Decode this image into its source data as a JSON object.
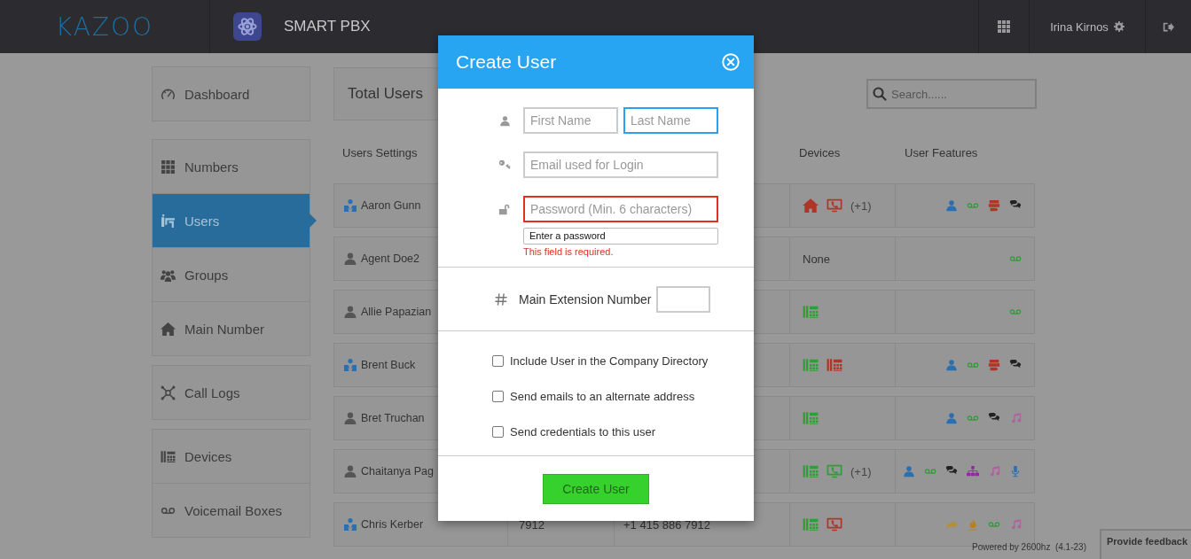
{
  "topbar": {
    "logo": "KAZOO",
    "app_title": "SMART PBX",
    "user_name": "Irina Kirnos"
  },
  "sidebar": {
    "groups": [
      {
        "items": [
          {
            "kind": "dashboard",
            "label": "Dashboard",
            "selected": false
          }
        ]
      },
      {
        "items": [
          {
            "kind": "numbers",
            "label": "Numbers",
            "selected": false
          },
          {
            "kind": "users",
            "label": "Users",
            "selected": true
          },
          {
            "kind": "groups",
            "label": "Groups",
            "selected": false
          },
          {
            "kind": "main_number",
            "label": "Main Number",
            "selected": false
          }
        ]
      },
      {
        "items": [
          {
            "kind": "call_logs",
            "label": "Call Logs",
            "selected": false
          }
        ]
      },
      {
        "items": [
          {
            "kind": "devices",
            "label": "Devices",
            "selected": false
          },
          {
            "kind": "voicemail",
            "label": "Voicemail Boxes",
            "selected": false
          }
        ]
      }
    ]
  },
  "summary": {
    "label": "Total Users"
  },
  "search": {
    "placeholder": "Search......"
  },
  "table": {
    "header": {
      "name": "Users Settings",
      "devices": "Devices",
      "features": "User Features"
    },
    "rows": [
      {
        "name": "Aaron Gunn",
        "kind": "admin",
        "devices": [
          {
            "kind": "landline",
            "color": "#b03527"
          },
          {
            "kind": "softphone",
            "color": "#b03527"
          }
        ],
        "devices_more": "(+1)",
        "features": [
          {
            "kind": "user"
          },
          {
            "kind": "voicemail"
          },
          {
            "kind": "fax"
          },
          {
            "kind": "chat"
          }
        ]
      },
      {
        "name": "Agent Doe2",
        "kind": "user",
        "devices": [],
        "devices_text": "None",
        "features": [
          {
            "kind": "voicemail"
          }
        ]
      },
      {
        "name": "Allie Papazian",
        "kind": "user",
        "devices": [
          {
            "kind": "desk_phone",
            "color": "#2f9e35"
          }
        ],
        "features": [
          {
            "kind": "voicemail"
          }
        ]
      },
      {
        "name": "Brent Buck",
        "kind": "admin",
        "devices": [
          {
            "kind": "desk_phone",
            "color": "#2f9e35"
          },
          {
            "kind": "desk_phone",
            "color": "#b03527"
          }
        ],
        "features": [
          {
            "kind": "user"
          },
          {
            "kind": "voicemail"
          },
          {
            "kind": "fax"
          },
          {
            "kind": "chat"
          }
        ]
      },
      {
        "name": "Bret Truchan",
        "kind": "user",
        "devices": [
          {
            "kind": "desk_phone",
            "color": "#2f9e35"
          }
        ],
        "features": [
          {
            "kind": "user"
          },
          {
            "kind": "voicemail"
          },
          {
            "kind": "chat"
          },
          {
            "kind": "music"
          }
        ]
      },
      {
        "name": "Chaitanya Pag",
        "kind": "user",
        "devices": [
          {
            "kind": "desk_phone",
            "color": "#2f9e35"
          },
          {
            "kind": "softphone",
            "color": "#2f9e35"
          }
        ],
        "devices_more": "(+1)",
        "features": [
          {
            "kind": "user"
          },
          {
            "kind": "voicemail"
          },
          {
            "kind": "chat"
          },
          {
            "kind": "org_chart"
          },
          {
            "kind": "music"
          },
          {
            "kind": "mic"
          }
        ]
      },
      {
        "name": "Chris Kerber",
        "kind": "admin",
        "extension": "7912",
        "number": "+1 415 886 7912",
        "devices": [
          {
            "kind": "desk_phone",
            "color": "#2f9e35"
          },
          {
            "kind": "softphone",
            "color": "#b03527"
          }
        ],
        "features": [
          {
            "kind": "forward"
          },
          {
            "kind": "flame"
          },
          {
            "kind": "voicemail"
          },
          {
            "kind": "music"
          }
        ]
      }
    ]
  },
  "modal": {
    "title": "Create User",
    "name_fields": [
      {
        "placeholder": "First Name",
        "focused": false
      },
      {
        "placeholder": "Last Name",
        "focused": true
      }
    ],
    "email": {
      "placeholder": "Email used for Login",
      "focused": false
    },
    "password": {
      "placeholder": "Password (Min. 6 characters)",
      "invalid": true,
      "hint": "Enter a password",
      "error": "This field is required."
    },
    "extension": {
      "label": "Main Extension Number"
    },
    "checkboxes": [
      {
        "label": "Include User in the Company Directory",
        "checked": false
      },
      {
        "label": "Send emails to an alternate address",
        "checked": false
      },
      {
        "label": "Send credentials to this user",
        "checked": false
      }
    ],
    "button": "Create User"
  },
  "footer": {
    "powered_by": "Powered by 2600hz",
    "version": "(4.1-23)",
    "feedback": "Provide feedback"
  }
}
